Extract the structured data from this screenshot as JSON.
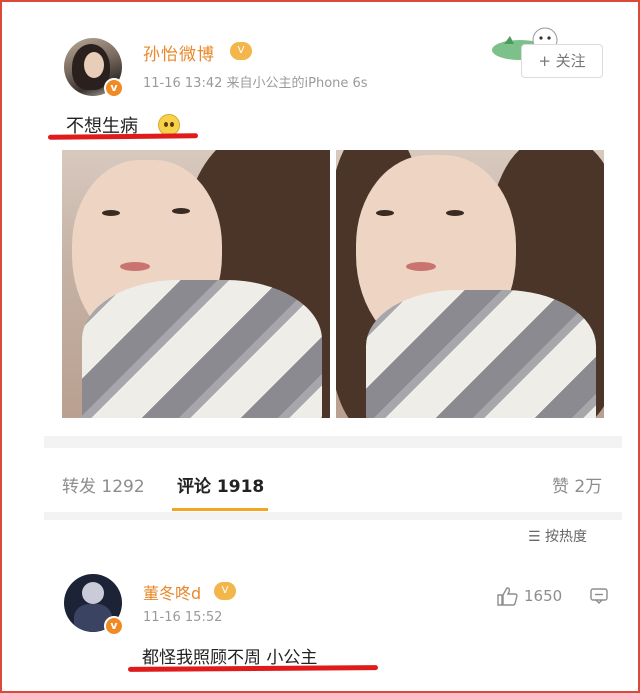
{
  "post": {
    "username": "孙怡微博",
    "meta": "11-16 13:42  来自小公主的iPhone 6s",
    "follow_label": "+ 关注",
    "text": "不想生病",
    "level_badge": "V"
  },
  "actions": {
    "repost": "转发 1292",
    "comment": "评论 1918",
    "like": "赞 2万"
  },
  "sort_label": "按热度",
  "comment": {
    "username": "董冬咚d",
    "meta": "11-16 15:52",
    "text": "都怪我照顾不周 小公主",
    "like_count": "1650"
  },
  "colors": {
    "username": "#e8882a",
    "tab_indicator": "#f4a623",
    "annotation_underline": "#e01b1b",
    "frame": "#d94a3a"
  },
  "icons": [
    "v-verified-icon",
    "level-badge-icon",
    "emoji-icon",
    "sort-icon",
    "thumbs-up-icon",
    "reply-icon"
  ]
}
